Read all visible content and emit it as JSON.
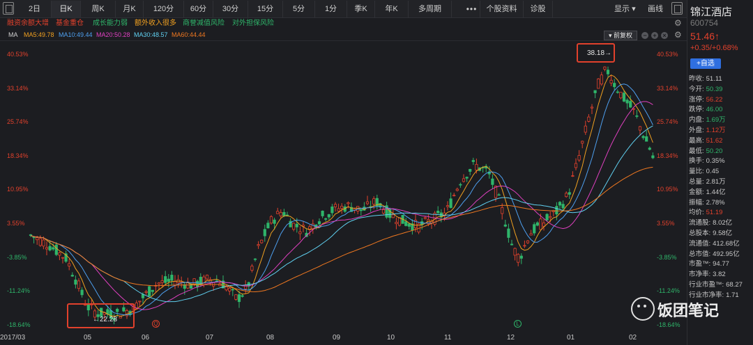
{
  "toolbar": {
    "periods": [
      "2日",
      "日K",
      "周K",
      "月K",
      "120分",
      "60分",
      "30分",
      "15分",
      "5分",
      "1分",
      "季K",
      "年K",
      "多周期"
    ],
    "active_period": "日K",
    "more": "•••",
    "extra": [
      "个股资料",
      "诊股"
    ],
    "display": "显示",
    "display_arrow": "▾",
    "draw": "画线"
  },
  "tags": [
    {
      "text": "融资余额大增",
      "color": "#e2412c"
    },
    {
      "text": "基金重仓",
      "color": "#e2412c"
    },
    {
      "text": "成长能力弱",
      "color": "#2fb56a"
    },
    {
      "text": "额外收入很多",
      "color": "#f0a020"
    },
    {
      "text": "商誉减值风险",
      "color": "#2fb56a"
    },
    {
      "text": "对外担保风险",
      "color": "#2fb56a"
    }
  ],
  "ma": {
    "label": "MA",
    "items": [
      {
        "text": "MA5:49.78",
        "color": "#f0a020"
      },
      {
        "text": "MA10:49.44",
        "color": "#4ea0f0"
      },
      {
        "text": "MA20:50.28",
        "color": "#e040c0"
      },
      {
        "text": "MA30:48.57",
        "color": "#60d0f0"
      },
      {
        "text": "MA60:44.44",
        "color": "#f07820"
      }
    ],
    "adjust": "前复权",
    "adjust_arrow": "▾",
    "minus": "−",
    "plus": "+",
    "close": "×"
  },
  "chart_data": {
    "type": "candlestick",
    "y_axis_ticks": [
      "40.53%",
      "33.14%",
      "25.74%",
      "18.34%",
      "10.95%",
      "3.55%",
      "-3.85%",
      "-11.24%",
      "-18.64%"
    ],
    "ylim": [
      -18.64,
      40.53
    ],
    "x_ticks": [
      "2017/03",
      "05",
      "06",
      "07",
      "08",
      "09",
      "10",
      "11",
      "12",
      "01",
      "02"
    ],
    "annotations": [
      {
        "text": "38.18→"
      },
      {
        "text": "←22.28"
      }
    ],
    "markers": [
      "Q",
      "L"
    ],
    "colors": {
      "up": "#e2412c",
      "down": "#2fb56a"
    }
  },
  "panel": {
    "name": "锦江酒店",
    "code": "600754",
    "price": "51.46↑",
    "change": "+0.35/+0.68%",
    "add": "+自选",
    "rows": [
      {
        "k": "昨收:",
        "v": "51.11",
        "c": "#c8c8c8"
      },
      {
        "k": "今开:",
        "v": "50.39",
        "c": "#2fb56a"
      },
      {
        "k": "涨停:",
        "v": "56.22",
        "c": "#e2412c"
      },
      {
        "k": "跌停:",
        "v": "46.00",
        "c": "#2fb56a"
      },
      {
        "k": "内盘:",
        "v": "1.69万",
        "c": "#2fb56a"
      },
      {
        "k": "外盘:",
        "v": "1.12万",
        "c": "#e2412c"
      },
      {
        "k": "最高:",
        "v": "51.62",
        "c": "#e2412c"
      },
      {
        "k": "最低:",
        "v": "50.20",
        "c": "#2fb56a"
      },
      {
        "k": "换手:",
        "v": "0.35%",
        "c": "#c8c8c8"
      },
      {
        "k": "量比:",
        "v": "0.45",
        "c": "#c8c8c8"
      },
      {
        "k": "总量:",
        "v": "2.81万",
        "c": "#c8c8c8"
      },
      {
        "k": "金额:",
        "v": "1.44亿",
        "c": "#c8c8c8"
      },
      {
        "k": "振幅:",
        "v": "2.78%",
        "c": "#c8c8c8"
      },
      {
        "k": "均价:",
        "v": "51.19",
        "c": "#e2412c"
      },
      {
        "k": "流通股:",
        "v": "8.02亿",
        "c": "#c8c8c8"
      },
      {
        "k": "总股本:",
        "v": "9.58亿",
        "c": "#c8c8c8"
      },
      {
        "k": "流通值:",
        "v": "412.68亿",
        "c": "#c8c8c8"
      },
      {
        "k": "总市值:",
        "v": "492.95亿",
        "c": "#c8c8c8"
      },
      {
        "k": "市盈™:",
        "v": "94.77",
        "c": "#c8c8c8"
      },
      {
        "k": "市净率:",
        "v": "3.82",
        "c": "#c8c8c8"
      },
      {
        "k": "行业市盈™:",
        "v": "68.27",
        "c": "#c8c8c8"
      },
      {
        "k": "行业市净率:",
        "v": "1.71",
        "c": "#c8c8c8"
      }
    ]
  },
  "watermark": {
    "text": "饭团笔记"
  }
}
